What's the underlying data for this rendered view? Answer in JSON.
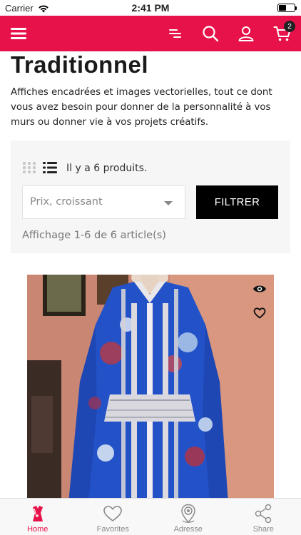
{
  "status_bar": {
    "carrier": "Carrier",
    "time": "2:41 PM"
  },
  "colors": {
    "brand": "#e8124a",
    "filter_button": "#000000",
    "badge": "#222222"
  },
  "navbar": {
    "icons": [
      "menu-icon",
      "sort-lines-icon",
      "search-icon",
      "user-icon",
      "cart-icon"
    ],
    "cart_count": "2"
  },
  "page": {
    "title": "Traditionnel",
    "description": "Affiches encadrées et images vectorielles, tout ce dont vous avez besoin pour donner de la personnalité à vos murs ou donner vie à vos projets créatifs."
  },
  "filters": {
    "product_count": "Il y a 6 produits.",
    "sort_selected": "Prix, croissant",
    "filter_button": "FILTRER",
    "showing": "Affichage 1-6 de 6 article(s)"
  },
  "product": {
    "icons": [
      "eye-icon",
      "heart-icon"
    ]
  },
  "tabbar": {
    "tabs": [
      {
        "label": "Home",
        "icon": "home-hanger-icon",
        "active": true
      },
      {
        "label": "Favorites",
        "icon": "heart-icon",
        "active": false
      },
      {
        "label": "Adresse",
        "icon": "map-pin-icon",
        "active": false
      },
      {
        "label": "Share",
        "icon": "share-icon",
        "active": false
      }
    ]
  }
}
